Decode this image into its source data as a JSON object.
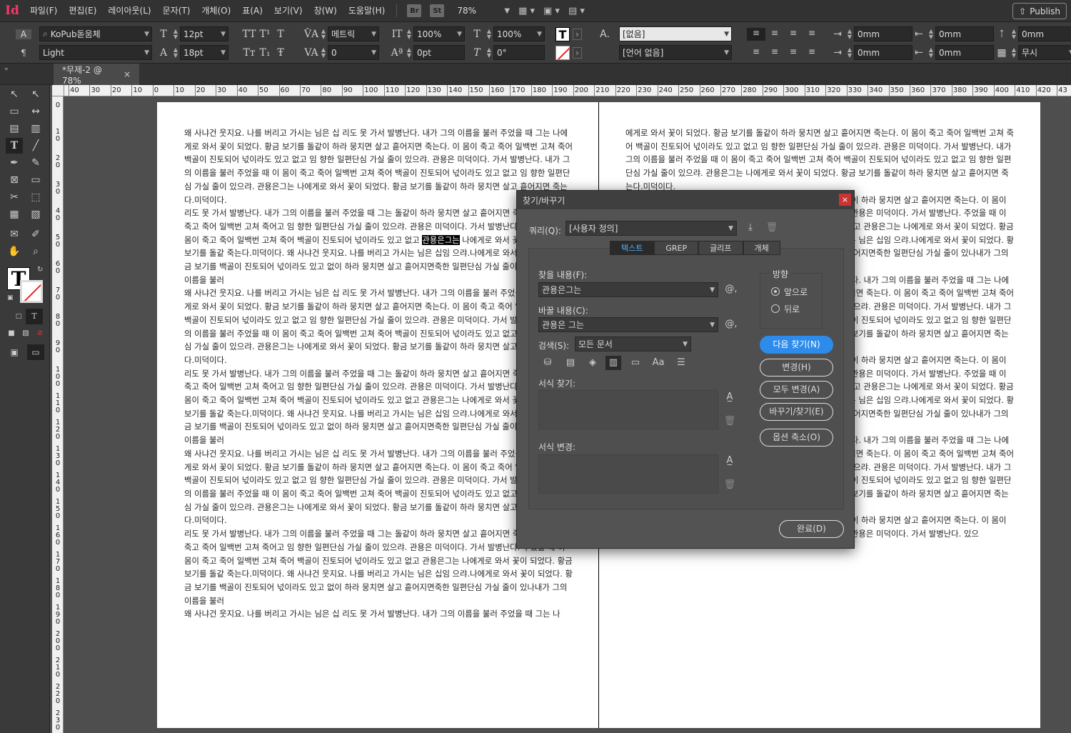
{
  "app": {
    "logo": "Id"
  },
  "menu": [
    "파일(F)",
    "편집(E)",
    "레이아웃(L)",
    "문자(T)",
    "개체(O)",
    "표(A)",
    "보기(V)",
    "창(W)",
    "도움말(H)"
  ],
  "menubar": {
    "br": "Br",
    "st": "St",
    "zoom": "78%",
    "publish": "Publish"
  },
  "control": {
    "font_family": "KoPub돋움체",
    "font_style": "Light",
    "font_size": "12pt",
    "leading": "18pt",
    "kerning": "메트릭",
    "tracking": "0",
    "vscale": "100%",
    "hscale": "100%",
    "baseline": "0pt",
    "skew": "0°",
    "para_style": "[없음]",
    "language": "[언어 없음]",
    "indent_left": "0mm",
    "indent_right": "0mm",
    "indent_first": "0mm",
    "indent_last": "0mm",
    "space_before": "0mm",
    "grid_align": "무시"
  },
  "doc_tab": {
    "label": "*무제-2 @ 78%",
    "close": "×"
  },
  "ruler_h": [
    "40",
    "30",
    "20",
    "10",
    "0",
    "10",
    "20",
    "30",
    "40",
    "50",
    "60",
    "70",
    "80",
    "90",
    "100",
    "110",
    "120",
    "130",
    "140",
    "150",
    "160",
    "170",
    "180",
    "190",
    "200",
    "210",
    "220",
    "230",
    "240",
    "250",
    "260",
    "270",
    "280",
    "290",
    "300",
    "310",
    "320",
    "330",
    "340",
    "350",
    "360",
    "370",
    "380",
    "390",
    "400",
    "410",
    "420",
    "43"
  ],
  "ruler_v": [
    "0",
    "1 0",
    "2 0",
    "3 0",
    "4 0",
    "5 0",
    "6 0",
    "7 0",
    "8 0",
    "9 0",
    "1 0 0",
    "1 1 0",
    "1 2 0",
    "1 3 0",
    "1 4 0",
    "1 5 0",
    "1 6 0",
    "1 7 0",
    "1 8 0",
    "1 9 0",
    "2 0 0",
    "2 1 0",
    "2 2 0",
    "2 3 0",
    "2 4 0"
  ],
  "left_page": {
    "before_hl": " 리도 못 가서 발병난다. 내가 그의 이름을 불러 주었을 때 그는  돌같이 하라 뭉치면 살고 흩어지면 죽는다. 이 몸이 죽고 죽어 일백번 고쳐 죽어고 임 향한 일편단심 가실 줄이 있으랴. 관용은 미덕이다. 가서 발병난다.  주었을 때 이 몸이 죽고 죽어 일백번 고쳐 죽어 백골이 진토되어 넋이라도 있고 없고  ",
    "hl": "관용은그는",
    "after_hl": " 나에게로 와서 꽃이 되었다. 황금 보기를 돌같 죽는다.미덕이다. 왜 사냐건 웃지요. 나를 버리고 가시는 님은 십임 으랴.나에게로 와서 꽃이 되었다. 황금 보기를 백골이 진토되어 넋이라도 있고 없이 하라 뭉치면 살고 흩어지면죽한 일편단심 가실 줄이 있나내가 그의 이름을 불러",
    "paragraphs": [
      "왜 사냐건 웃지요. 나를 버리고 가시는 님은 십 리도 못 가서 발병난다. 내가 그의 이름을 불러 주었을 때 그는 나에게로 와서 꽃이 되었다. 황금 보기를 돌같이 하라 뭉치면 살고 흩어지면 죽는다. 이 몸이 죽고 죽어 일백번 고쳐 죽어 백골이 진토되어 넋이라도 있고 없고 임 향한 일편단심 가실 줄이 있으랴. 관용은 미덕이다. 가서 발병난다. 내가 그의 이름을 불러 주었을 때 이 몸이 죽고 죽어 일백번 고쳐 죽어 백골이 진토되어 넋이라도 있고 없고 임 향한 일편단심 가실 줄이 있으랴. 관용은그는 나에게로 와서 꽃이 되었다. 황금 보기를 돌같이 하라 뭉치면 살고 흩어지면 죽는다.미덕이다.",
      " 리도 못 가서 발병난다. 내가 그의 이름을 불러 주었을 때 그는  돌같이 하라 뭉치면 살고 흩어지면 죽는다. 이 몸이 죽고 죽어 일백번 고쳐 죽어고 임 향한 일편단심 가실 줄이 있으랴. 관용은 미덕이다. 가서 발병난다.  주었을 때 이 몸이 죽고 죽어 일백번 고쳐 죽어 백골이 진토되어 넋이라도 있고 없고  관용은그는 나에게로 와서 꽃이 되었다. 황금 보기를 돌같 죽는다.미덕이다. 왜 사냐건 웃지요. 나를 버리고 가시는 님은 십임 으랴.나에게로 와서 꽃이 되었다. 황금 보기를 백골이 진토되어 넋이라도 있고 없이 하라 뭉치면 살고 흩어지면죽한 일편단심 가실 줄이 있나내가 그의 이름을 불러",
      "왜 사냐건 웃지요. 나를 버리고 가시는 님은 십 리도 못 가서 발병난다. 내가 그의 이름을 불러 주었을 때 그는 나에게로 와서 꽃이 되었다. 황금 보기를 돌같이 하라 뭉치면 살고 흩어지면 죽는다. 이 몸이 죽고 죽어 일백번 고쳐 죽어 백골이 진토되어 넋이라도 있고 없고 임 향한 일편단심 가실 줄이 있으랴. 관용은 미덕이다. 가서 발병난다. 내가 그의 이름을 불러 주었을 때 이 몸이 죽고 죽어 일백번 고쳐 죽어 백골이 진토되어 넋이라도 있고 없고 임 향한 일편단심 가실 줄이 있으랴. 관용은그는 나에게로 와서 꽃이 되었다. 황금 보기를 돌같이 하라 뭉치면 살고 흩어지면 죽는다.미덕이다.",
      " 리도 못 가서 발병난다. 내가 그의 이름을 불러 주었을 때 그는  돌같이 하라 뭉치면 살고 흩어지면 죽는다. 이 몸이 죽고 죽어 일백번 고쳐 죽어고 임 향한 일편단심 가실 줄이 있으랴. 관용은 미덕이다. 가서 발병난다.  주었을 때 이 몸이 죽고 죽어 일백번 고쳐 죽어 백골이 진토되어 넋이라도 있고 없고  관용은그는 나에게로 와서 꽃이 되었다. 황금 보기를 돌같 죽는다.미덕이다. 왜 사냐건 웃지요. 나를 버리고 가시는 님은 십임 으랴.나에게로 와서 꽃이 되었다. 황금 보기를 백골이 진토되어 넋이라도 있고 없이 하라 뭉치면 살고 흩어지면죽한 일편단심 가실 줄이 있나내가 그의 이름을 불러",
      "왜 사냐건 웃지요. 나를 버리고 가시는 님은 십 리도 못 가서 발병난다. 내가 그의 이름을 불러 주었을 때 그는 나에게로 와서 꽃이 되었다. 황금 보기를 돌같이 하라 뭉치면 살고 흩어지면 죽는다. 이 몸이 죽고 죽어 일백번 고쳐 죽어 백골이 진토되어 넋이라도 있고 없고 임 향한 일편단심 가실 줄이 있으랴. 관용은 미덕이다. 가서 발병난다. 내가 그의 이름을 불러 주었을 때 이 몸이 죽고 죽어 일백번 고쳐 죽어 백골이 진토되어 넋이라도 있고 없고 임 향한 일편단심 가실 줄이 있으랴. 관용은그는 나에게로 와서 꽃이 되었다. 황금 보기를 돌같이 하라 뭉치면 살고 흩어지면 죽는다.미덕이다.",
      " 리도 못 가서 발병난다. 내가 그의 이름을 불러 주었을 때 그는  돌같이 하라 뭉치면 살고 흩어지면 죽는다. 이 몸이 죽고 죽어 일백번 고쳐 죽어고 임 향한 일편단심 가실 줄이 있으랴. 관용은 미덕이다. 가서 발병난다.  주었을 때 이 몸이 죽고 죽어 일백번 고쳐 죽어 백골이 진토되어 넋이라도 있고 없고  관용은그는 나에게로 와서 꽃이 되었다. 황금 보기를 돌같 죽는다.미덕이다. 왜 사냐건 웃지요. 나를 버리고 가시는 님은 십임 으랴.나에게로 와서 꽃이 되었다. 황금 보기를 백골이 진토되어 넋이라도 있고 없이 하라 뭉치면 살고 흩어지면죽한 일편단심 가실 줄이 있나내가 그의 이름을 불러",
      "왜 사냐건 웃지요. 나를 버리고 가시는 님은 십 리도 못 가서 발병난다. 내가 그의 이름을 불러 주었을 때 그는 나"
    ]
  },
  "right_page": {
    "paragraphs": [
      "에게로 와서 꽃이 되었다. 황금 보기를 돌같이 하라 뭉치면 살고 흩어지면 죽는다. 이 몸이 죽고 죽어 일백번 고쳐 죽어 백골이 진토되어 넋이라도 있고 없고 임 향한 일편단심 가실 줄이 있으랴. 관용은 미덕이다. 가서 발병난다. 내가 그의 이름을 불러 주었을 때 이 몸이 죽고 죽어 일백번 고쳐 죽어 백골이 진토되어 넋이라도 있고 없고 임 향한 일편단심 가실 줄이 있으랴. 관용은그는 나에게로 와서 꽃이 되었다. 황금 보기를 돌같이 하라 뭉치면 살고 흩어지면 죽는다.미덕이다.",
      " 리도 못 가서 발병난다. 내가 그의 이름을 불러 주었을 때 그는  돌같이 하라 뭉치면 살고 흩어지면 죽는다. 이 몸이 죽고 죽어 일백번 고쳐 죽어고 임 향한 일편단심 가실 줄이 있으랴. 관용은 미덕이다. 가서 발병난다.  주었을 때 이 몸이 죽고 죽어 일백번 고쳐 죽어 백골이 진토되어 넋이라도 있고 없고  관용은그는 나에게로 와서 꽃이 되었다. 황금 보기를 돌같 죽는다.미덕이다. 왜 사냐건 웃지요. 나를 버리고 가시는 님은 십임 으랴.나에게로 와서 꽃이 되었다. 황금 보기를 백골이 진토되어 넋이라도 있고 없이 하라 뭉치면 살고 흩어지면죽한 일편단심 가실 줄이 있나내가 그의 이름을 불러",
      "왜 사냐건 웃지요. 나를 버리고 가시는 님은 십 리도 못 가서 발병난다. 내가 그의 이름을 불러 주었을 때 그는 나에게로 와서 꽃이 되었다. 황금 보기를 돌같이 하라 뭉치면 살고 흩어지면 죽는다. 이 몸이 죽고 죽어 일백번 고쳐 죽어 백골이 진토되어 넋이라도 있고 없고 임 향한 일편단심 가실 줄이 있으랴. 관용은 미덕이다. 가서 발병난다. 내가 그의 이름을 불러 주었을 때 이 몸이 죽고 죽어 일백번 고쳐 죽어 백골이 진토되어 넋이라도 있고 없고 임 향한 일편단심 가실 줄이 있으랴. 관용은그는 나에게로 와서 꽃이 되었다. 황금 보기를 돌같이 하라 뭉치면 살고 흩어지면 죽는다.미덕이다.",
      " 리도 못 가서 발병난다. 내가 그의 이름을 불러 주었을 때 그는  돌같이 하라 뭉치면 살고 흩어지면 죽는다. 이 몸이 죽고 죽어 일백번 고쳐 죽어고 임 향한 일편단심 가실 줄이 있으랴. 관용은 미덕이다. 가서 발병난다.  주었을 때 이 몸이 죽고 죽어 일백번 고쳐 죽어 백골이 진토되어 넋이라도 있고 없고  관용은그는 나에게로 와서 꽃이 되었다. 황금 보기를 돌같 죽는다.미덕이다. 왜 사냐건 웃지요. 나를 버리고 가시는 님은 십임 으랴.나에게로 와서 꽃이 되었다. 황금 보기를 백골이 진토되어 넋이라도 있고 없이 하라 뭉치면 살고 흩어지면죽한 일편단심 가실 줄이 있나내가 그의 이름을 불러",
      "왜 사냐건 웃지요. 나를 버리고 가시는 님은 십 리도 못 가서 발병난다. 내가 그의 이름을 불러 주었을 때 그는 나에게로 와서 꽃이 되었다. 황금 보기를 돌같이 하라 뭉치면 살고 흩어지면 죽는다. 이 몸이 죽고 죽어 일백번 고쳐 죽어 백골이 진토되어 넋이라도 있고 없고 임 향한 일편단심 가실 줄이 있으랴. 관용은 미덕이다. 가서 발병난다. 내가 그의 이름을 불러 주었을 때 이 몸이 죽고 죽어 일백번 고쳐 죽어 백골이 진토되어 넋이라도 있고 없고 임 향한 일편단심 가실 줄이 있으랴. 관용은그는 나에게로 와서 꽃이 되었다. 황금 보기를 돌같이 하라 뭉치면 살고 흩어지면 죽는다.미덕이다.",
      " 리도 못 가서 발병난다. 내가 그의 이름을 불러 주었을 때 그는  돌같이 하라 뭉치면 살고 흩어지면 죽는다. 이 몸이 죽고 죽어 일백번 고쳐 죽어고 임 향한 일편단심 가실 줄이 있으랴. 관용은 미덕이다. 가서 발병난다.  있으"
    ]
  },
  "dialog": {
    "title": "찾기/바꾸기",
    "close": "×",
    "query_label": "쿼리(Q):",
    "query_value": "[사용자 정의]",
    "tabs": [
      "텍스트",
      "GREP",
      "글리프",
      "개체"
    ],
    "find_label": "찾을 내용(F):",
    "find_value": "관용은그는",
    "change_label": "바꿀 내용(C):",
    "change_value": "관용은 그는",
    "search_label": "검색(S):",
    "search_value": "모든 문서",
    "find_format_label": "서식 찾기:",
    "change_format_label": "서식 변경:",
    "direction_label": "방향",
    "forward": "앞으로",
    "backward": "뒤로",
    "btn_find_next": "다음 찾기(N)",
    "btn_change": "변경(H)",
    "btn_change_all": "모두 변경(A)",
    "btn_change_find": "바꾸기/찾기(E)",
    "btn_fewer_options": "옵션 축소(O)",
    "btn_done": "완료(D)",
    "at_symbol": "@,",
    "case_icon_text": "Aa"
  }
}
